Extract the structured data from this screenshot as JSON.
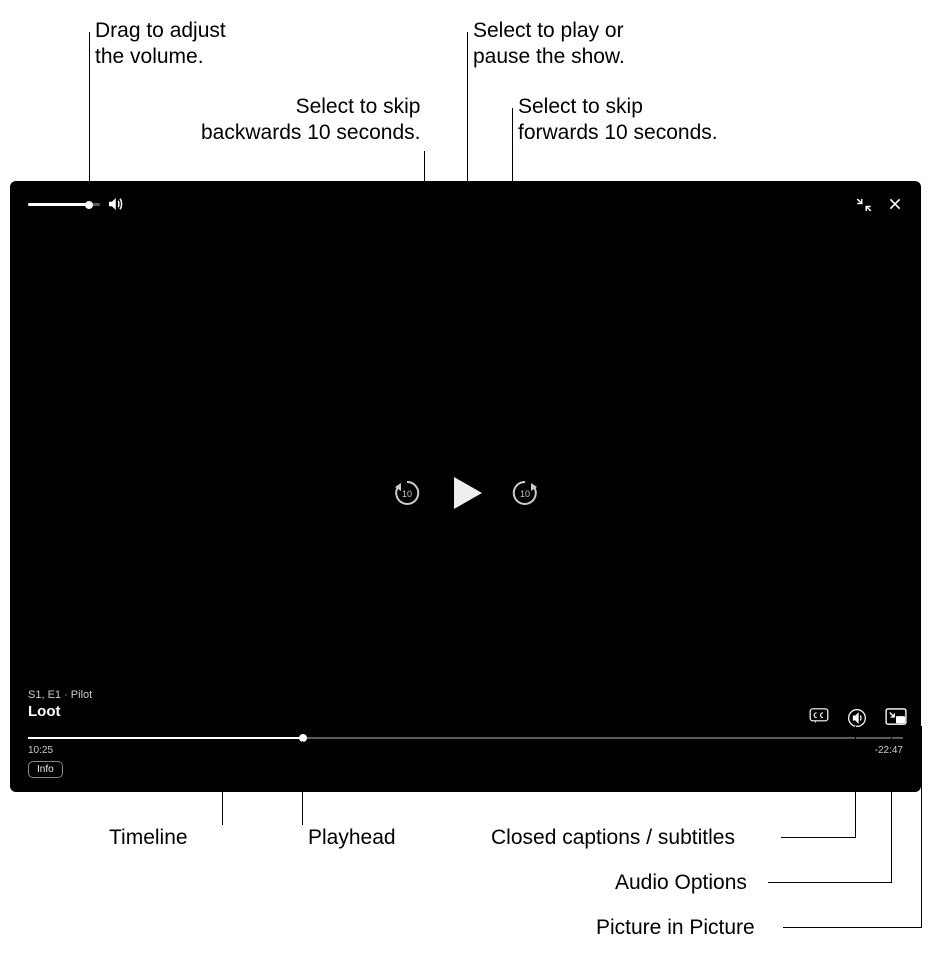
{
  "callouts": {
    "volume": "Drag to adjust\nthe volume.",
    "skip_back": "Select to skip\nbackwards 10 seconds.",
    "play_pause": "Select to play or\npause the show.",
    "skip_forward": "Select to skip\nforwards 10 seconds.",
    "timeline": "Timeline",
    "playhead": "Playhead",
    "cc": "Closed captions / subtitles",
    "audio_options": "Audio Options",
    "pip": "Picture in Picture"
  },
  "player": {
    "subtitle": "S1, E1 · Pilot",
    "title": "Loot",
    "elapsed": "10:25",
    "remaining": "-22:47",
    "info_label": "Info",
    "skip_seconds": "10",
    "volume_percent": 85,
    "progress_percent": 31.4
  }
}
